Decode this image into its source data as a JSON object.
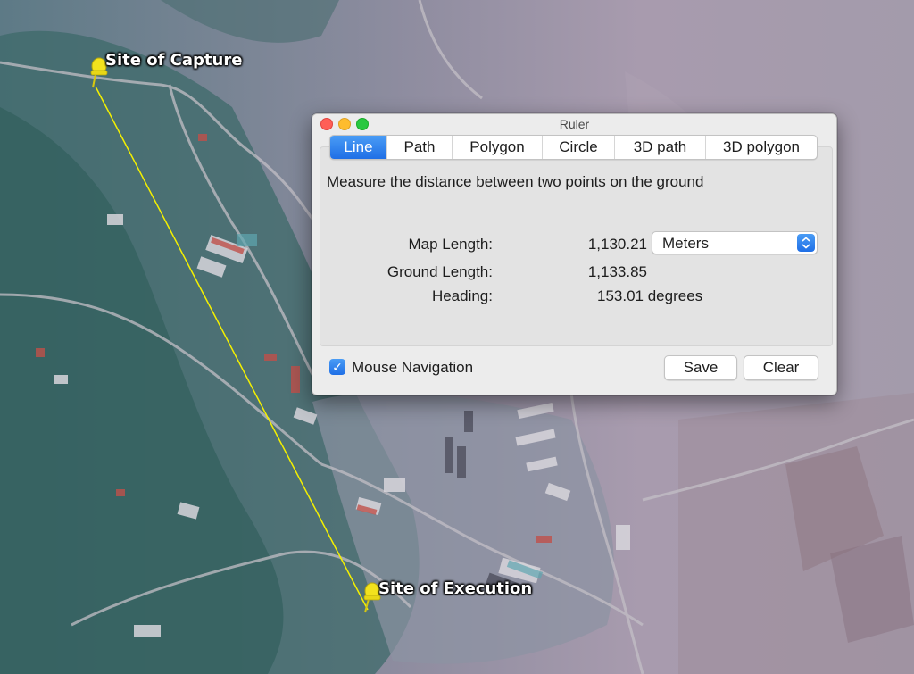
{
  "map": {
    "placemarks": [
      {
        "label": "Site of Capture",
        "pin_color": "#f2e21d"
      },
      {
        "label": "Site of Execution",
        "pin_color": "#f2e21d"
      }
    ],
    "measure_line_color": "#f4f000"
  },
  "ruler": {
    "title": "Ruler",
    "tabs": [
      {
        "label": "Line",
        "active": true
      },
      {
        "label": "Path",
        "active": false
      },
      {
        "label": "Polygon",
        "active": false
      },
      {
        "label": "Circle",
        "active": false
      },
      {
        "label": "3D path",
        "active": false
      },
      {
        "label": "3D polygon",
        "active": false
      }
    ],
    "description": "Measure the distance between two points on the ground",
    "map_length": {
      "label": "Map Length:",
      "value": "1,130.21"
    },
    "ground_length": {
      "label": "Ground Length:",
      "value": "1,133.85"
    },
    "heading": {
      "label": "Heading:",
      "value": "153.01 degrees"
    },
    "unit_select": {
      "value": "Meters",
      "arrows_icon": "up-down-chevron-icon"
    },
    "mouse_navigation": {
      "label": "Mouse Navigation",
      "checked": true,
      "check_glyph": "✓"
    },
    "save_label": "Save",
    "clear_label": "Clear",
    "accent_color": "#1f6fe6"
  }
}
